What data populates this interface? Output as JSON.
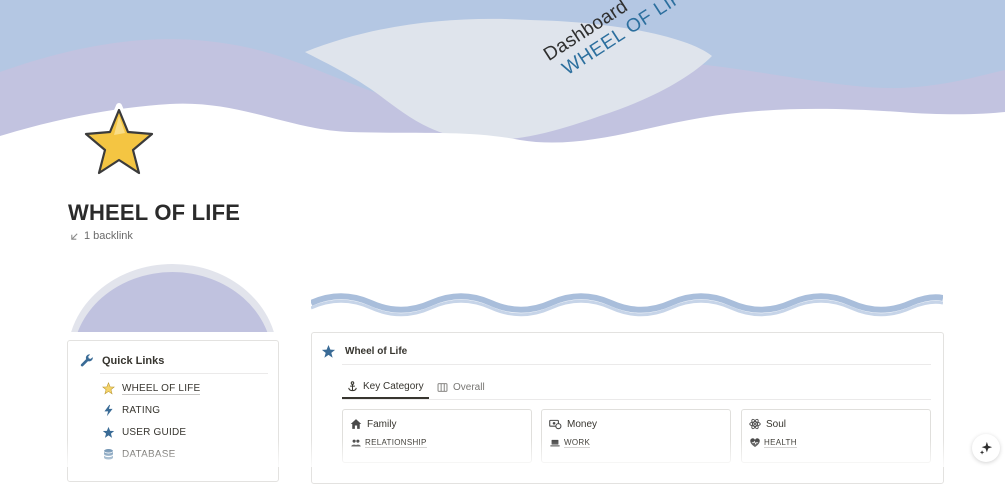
{
  "cover": {
    "subtitle": "Dashboard",
    "title": "WHEEL OF LIFE"
  },
  "page": {
    "title": "WHEEL OF LIFE",
    "backlinks": "1 backlink",
    "icon": "star-icon"
  },
  "quick_links": {
    "title": "Quick Links",
    "icon": "wrench-icon",
    "items": [
      {
        "label": "WHEEL OF LIFE",
        "icon": "star-emoji-icon"
      },
      {
        "label": "RATING",
        "icon": "bolt-icon"
      },
      {
        "label": "USER GUIDE",
        "icon": "star-icon"
      },
      {
        "label": "DATABASE",
        "icon": "database-icon"
      }
    ]
  },
  "wheel": {
    "title": "Wheel of Life",
    "icon": "star-icon",
    "tabs": [
      {
        "label": "Key Category",
        "icon": "anchor-icon",
        "active": true
      },
      {
        "label": "Overall",
        "icon": "columns-icon",
        "active": false
      }
    ],
    "cards": [
      {
        "title": "Family",
        "title_icon": "home-icon",
        "tag": "RELATIONSHIP",
        "tag_icon": "people-icon"
      },
      {
        "title": "Money",
        "title_icon": "money-icon",
        "tag": "WORK",
        "tag_icon": "laptop-icon"
      },
      {
        "title": "Soul",
        "title_icon": "atom-icon",
        "tag": "HEALTH",
        "tag_icon": "heart-pulse-icon"
      }
    ]
  },
  "colors": {
    "sky": "#b4c7e3",
    "wave_lilac": "#bfc2df",
    "cloud": "#dfe4ec",
    "accent_blue": "#3a6b96",
    "title_blue": "#2c6f9e"
  }
}
